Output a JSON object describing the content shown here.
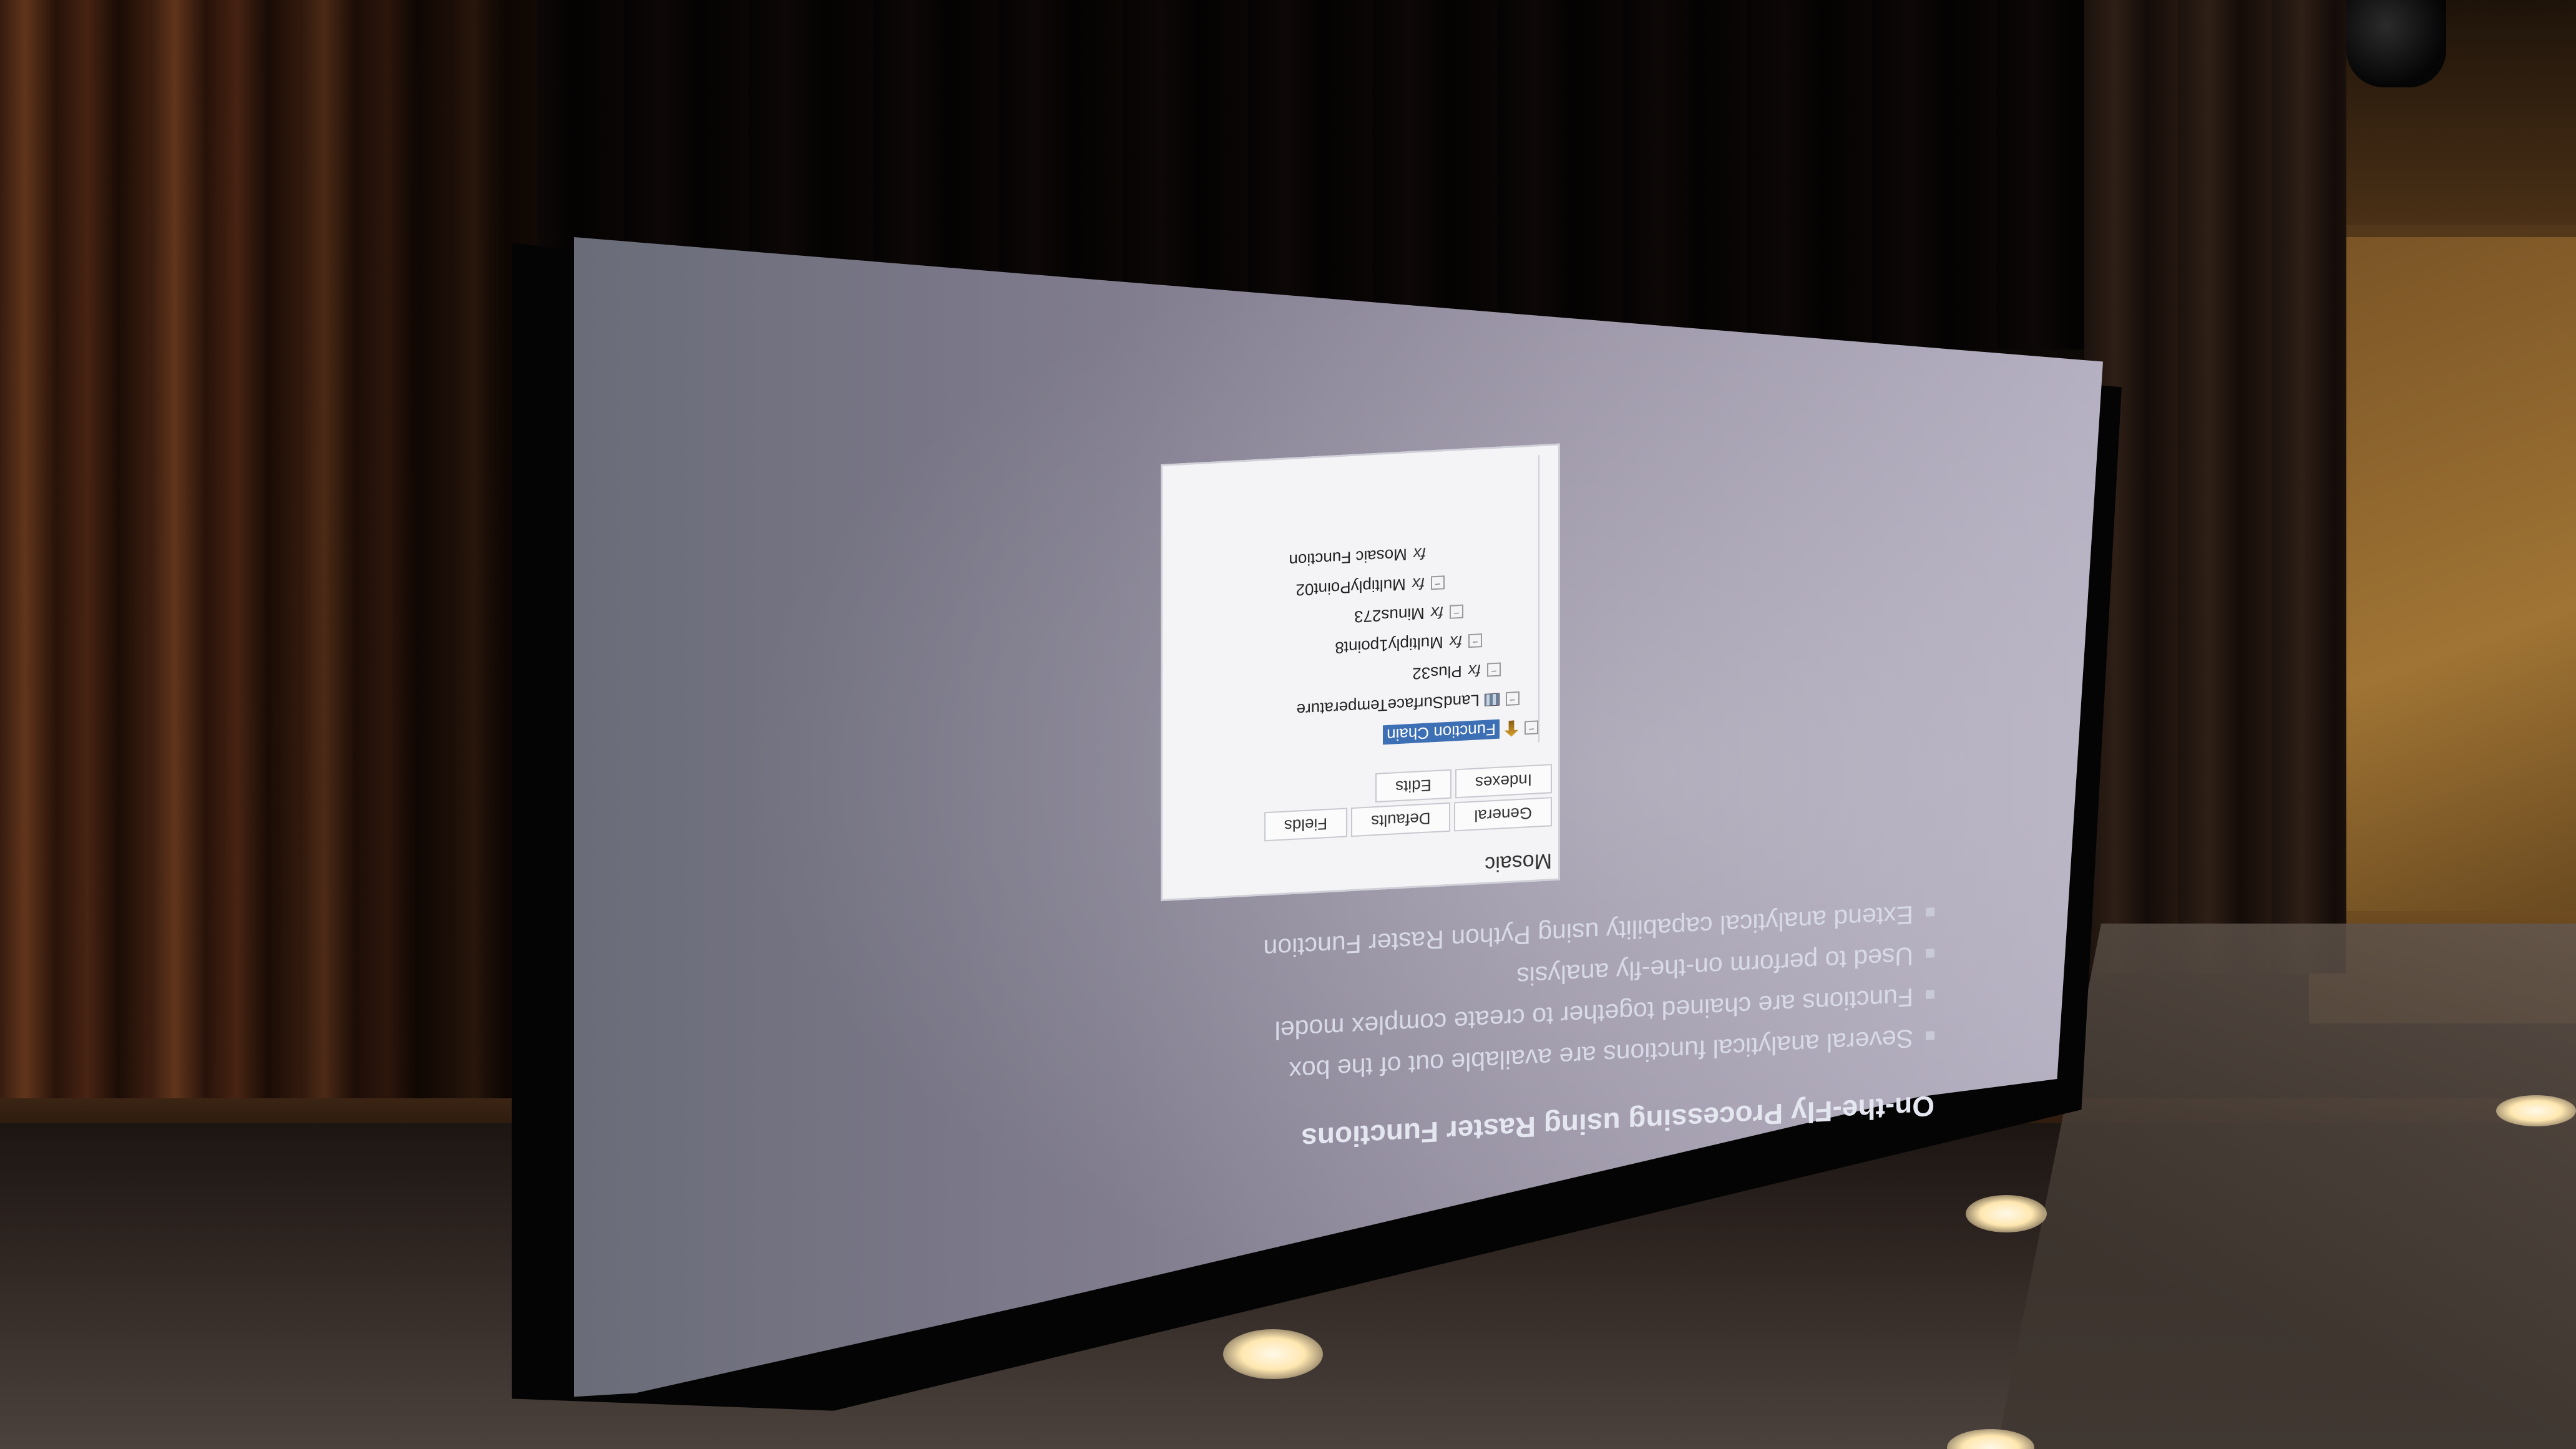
{
  "slide": {
    "title": "On-the-Fly Processing using Raster Functions",
    "bullets": [
      "Several analytical functions are available out of the box",
      "Functions are chained together to create complex model",
      "Used to perform on-the-fly analysis",
      "Extend analytical capability using Python Raster Function"
    ],
    "dialog": {
      "title": "Mosaic",
      "tabs": [
        "General",
        "Defaults",
        "Fields",
        "Indexes",
        "Edits"
      ],
      "tree": [
        {
          "label": "Function Chain",
          "icon": "function-chain-icon",
          "selected": true
        },
        {
          "label": "LandSurfaceTemperature",
          "icon": "raster-icon"
        },
        {
          "label": "Plus32",
          "icon": "fx-icon"
        },
        {
          "label": "Multiply1point8",
          "icon": "fx-icon"
        },
        {
          "label": "Minus273",
          "icon": "fx-icon"
        },
        {
          "label": "MultiplyPoint02",
          "icon": "fx-icon"
        },
        {
          "label": "Mosaic Function",
          "icon": "fx-icon"
        }
      ]
    }
  },
  "colors": {
    "screen": "#9a94a6",
    "slide_text": "#e4e6f0",
    "selection": "#3d6fb5",
    "curtain": "#6a3a1e"
  }
}
